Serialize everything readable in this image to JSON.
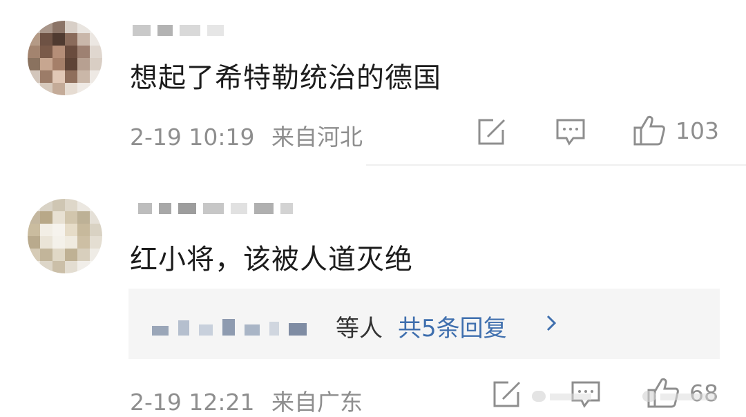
{
  "comments": [
    {
      "text": "想起了希特勒统治的德国",
      "date": "2-19 10:19",
      "location": "来自河北",
      "likes": "103"
    },
    {
      "text": "红小将，该被人道灭绝",
      "date": "2-19 12:21",
      "location": "来自广东",
      "likes": "68",
      "replies": {
        "suffix": "等人",
        "link_text": "共5条回复"
      }
    }
  ]
}
